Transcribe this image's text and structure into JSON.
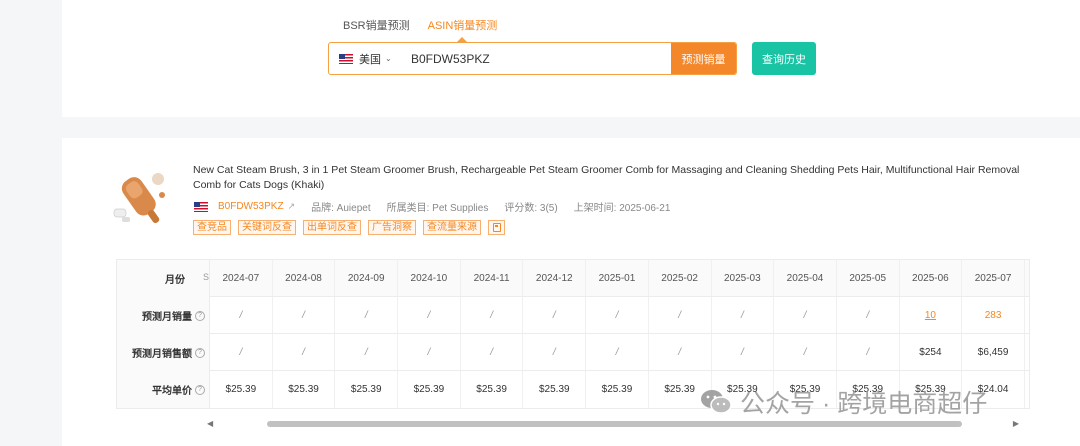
{
  "search": {
    "tabs": [
      {
        "label": "BSR销量预测",
        "active": false
      },
      {
        "label": "ASIN销量预测",
        "active": true
      }
    ],
    "country": "美国",
    "asin_value": "B0FDW53PKZ",
    "predict_button": "预测销量",
    "history_button": "查询历史"
  },
  "product": {
    "title": "New Cat Steam Brush, 3 in 1 Pet Steam Groomer Brush, Rechargeable Pet Steam Groomer Comb for Massaging and Cleaning Shedding Pets Hair, Multifunctional Hair Removal Comb for Cats Dogs (Khaki)",
    "asin": "B0FDW53PKZ",
    "brand": "品牌: Auiepet",
    "category": "所属类目: Pet Supplies",
    "rating": "评分数: 3(5)",
    "launch_date": "上架时间: 2025-06-21",
    "tags": [
      "查竞品",
      "关键词反查",
      "出单词反查",
      "广告洞察",
      "查流量来源"
    ]
  },
  "table": {
    "truncated_marker": "S",
    "row_labels": {
      "month": "月份",
      "units": "预测月销量",
      "revenue": "预测月销售额",
      "price": "平均单价"
    },
    "months": [
      "2024-07",
      "2024-08",
      "2024-09",
      "2024-10",
      "2024-11",
      "2024-12",
      "2025-01",
      "2025-02",
      "2025-03",
      "2025-04",
      "2025-05",
      "2025-06",
      "2025-07"
    ],
    "units": [
      "/",
      "/",
      "/",
      "/",
      "/",
      "/",
      "/",
      "/",
      "/",
      "/",
      "/",
      "10",
      "283"
    ],
    "revenue": [
      "/",
      "/",
      "/",
      "/",
      "/",
      "/",
      "/",
      "/",
      "/",
      "/",
      "/",
      "$254",
      "$6,459"
    ],
    "price": [
      "$25.39",
      "$25.39",
      "$25.39",
      "$25.39",
      "$25.39",
      "$25.39",
      "$25.39",
      "$25.39",
      "$25.39",
      "$25.39",
      "$25.39",
      "$25.39",
      "$24.04"
    ]
  },
  "watermark": "公众号 · 跨境电商超仔",
  "colors": {
    "accent_orange": "#f5871f",
    "teal": "#18c4a4"
  }
}
